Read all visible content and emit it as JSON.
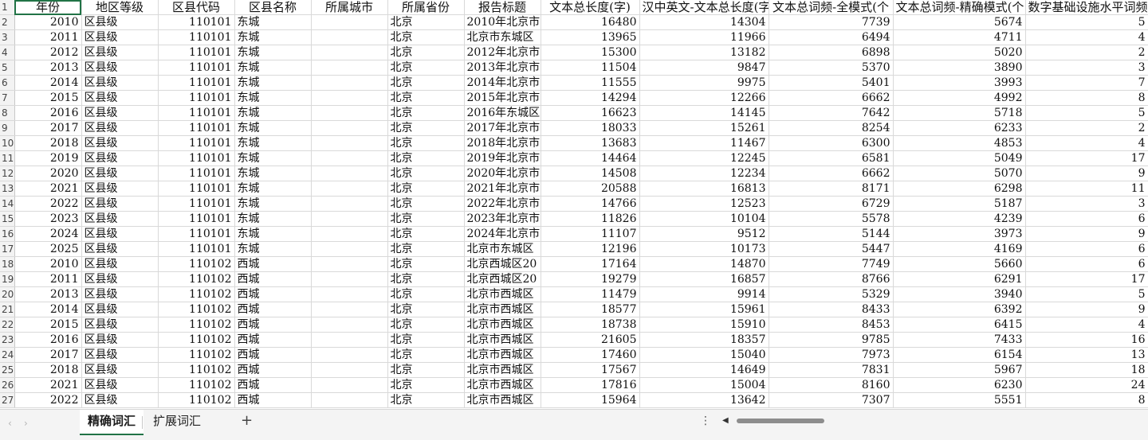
{
  "headers": [
    "年份",
    "地区等级",
    "区县代码",
    "区县名称",
    "所属城市",
    "所属省份",
    "报告标题",
    "文本总长度(字)",
    "汉中英文-文本总长度(字",
    "文本总词频-全模式(个",
    "文本总词频-精确模式(个",
    "数字基础设施水平词频"
  ],
  "row_numbers": [
    "1",
    "2",
    "3",
    "4",
    "5",
    "6",
    "7",
    "8",
    "9",
    "10",
    "11",
    "12",
    "13",
    "14",
    "15",
    "16",
    "17",
    "18",
    "19",
    "20",
    "21",
    "22",
    "23",
    "24",
    "25",
    "26",
    "27"
  ],
  "rows": [
    [
      "2010",
      "区县级",
      "110101",
      "东城",
      "",
      "北京",
      "2010年北京市",
      "16480",
      "14304",
      "7739",
      "5674",
      "5"
    ],
    [
      "2011",
      "区县级",
      "110101",
      "东城",
      "",
      "北京",
      "北京市东城区",
      "13965",
      "11966",
      "6494",
      "4711",
      "4"
    ],
    [
      "2012",
      "区县级",
      "110101",
      "东城",
      "",
      "北京",
      "2012年北京市",
      "15300",
      "13182",
      "6898",
      "5020",
      "2"
    ],
    [
      "2013",
      "区县级",
      "110101",
      "东城",
      "",
      "北京",
      "2013年北京市",
      "11504",
      "9847",
      "5370",
      "3890",
      "3"
    ],
    [
      "2014",
      "区县级",
      "110101",
      "东城",
      "",
      "北京",
      "2014年北京市",
      "11555",
      "9975",
      "5401",
      "3993",
      "7"
    ],
    [
      "2015",
      "区县级",
      "110101",
      "东城",
      "",
      "北京",
      "2015年北京市",
      "14294",
      "12266",
      "6662",
      "4992",
      "8"
    ],
    [
      "2016",
      "区县级",
      "110101",
      "东城",
      "",
      "北京",
      "2016年东城区",
      "16623",
      "14145",
      "7642",
      "5718",
      "5"
    ],
    [
      "2017",
      "区县级",
      "110101",
      "东城",
      "",
      "北京",
      "2017年北京市",
      "18033",
      "15261",
      "8254",
      "6233",
      "2"
    ],
    [
      "2018",
      "区县级",
      "110101",
      "东城",
      "",
      "北京",
      "2018年北京市",
      "13683",
      "11467",
      "6300",
      "4853",
      "4"
    ],
    [
      "2019",
      "区县级",
      "110101",
      "东城",
      "",
      "北京",
      "2019年北京市",
      "14464",
      "12245",
      "6581",
      "5049",
      "17"
    ],
    [
      "2020",
      "区县级",
      "110101",
      "东城",
      "",
      "北京",
      "2020年北京市",
      "14508",
      "12234",
      "6662",
      "5070",
      "9"
    ],
    [
      "2021",
      "区县级",
      "110101",
      "东城",
      "",
      "北京",
      "2021年北京市",
      "20588",
      "16813",
      "8171",
      "6298",
      "11"
    ],
    [
      "2022",
      "区县级",
      "110101",
      "东城",
      "",
      "北京",
      "2022年北京市",
      "14766",
      "12523",
      "6729",
      "5187",
      "3"
    ],
    [
      "2023",
      "区县级",
      "110101",
      "东城",
      "",
      "北京",
      "2023年北京市",
      "11826",
      "10104",
      "5578",
      "4239",
      "6"
    ],
    [
      "2024",
      "区县级",
      "110101",
      "东城",
      "",
      "北京",
      "2024年北京市",
      "11107",
      "9512",
      "5144",
      "3973",
      "9"
    ],
    [
      "2025",
      "区县级",
      "110101",
      "东城",
      "",
      "北京",
      "北京市东城区",
      "12196",
      "10173",
      "5447",
      "4169",
      "6"
    ],
    [
      "2010",
      "区县级",
      "110102",
      "西城",
      "",
      "北京",
      "北京西城区20",
      "17164",
      "14870",
      "7749",
      "5660",
      "6"
    ],
    [
      "2011",
      "区县级",
      "110102",
      "西城",
      "",
      "北京",
      "北京西城区20",
      "19279",
      "16857",
      "8766",
      "6291",
      "17"
    ],
    [
      "2013",
      "区县级",
      "110102",
      "西城",
      "",
      "北京",
      "北京市西城区",
      "11479",
      "9914",
      "5329",
      "3940",
      "5"
    ],
    [
      "2014",
      "区县级",
      "110102",
      "西城",
      "",
      "北京",
      "北京市西城区",
      "18577",
      "15961",
      "8433",
      "6392",
      "9"
    ],
    [
      "2015",
      "区县级",
      "110102",
      "西城",
      "",
      "北京",
      "北京市西城区",
      "18738",
      "15910",
      "8453",
      "6415",
      "4"
    ],
    [
      "2016",
      "区县级",
      "110102",
      "西城",
      "",
      "北京",
      "北京市西城区",
      "21605",
      "18357",
      "9785",
      "7433",
      "16"
    ],
    [
      "2017",
      "区县级",
      "110102",
      "西城",
      "",
      "北京",
      "北京市西城区",
      "17460",
      "15040",
      "7973",
      "6154",
      "13"
    ],
    [
      "2018",
      "区县级",
      "110102",
      "西城",
      "",
      "北京",
      "北京市西城区",
      "17567",
      "14649",
      "7831",
      "5967",
      "18"
    ],
    [
      "2021",
      "区县级",
      "110102",
      "西城",
      "",
      "北京",
      "北京市西城区",
      "17816",
      "15004",
      "8160",
      "6230",
      "24"
    ],
    [
      "2022",
      "区县级",
      "110102",
      "西城",
      "",
      "北京",
      "北京市西城区",
      "15964",
      "13642",
      "7307",
      "5551",
      "8"
    ]
  ],
  "tabs": [
    "精确词汇",
    "扩展词汇"
  ],
  "add_tab": "+",
  "nav": {
    "prev": "‹",
    "next": "›"
  },
  "more": "⋮",
  "scroll_left": "◀"
}
